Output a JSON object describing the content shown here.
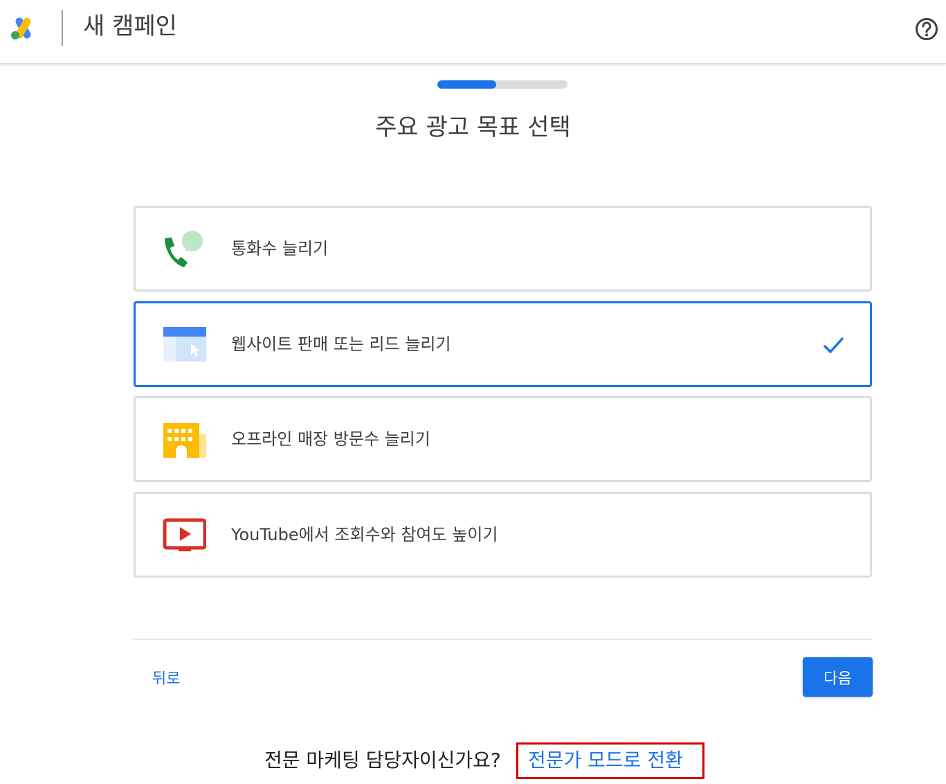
{
  "header": {
    "title": "새 캠페인",
    "logo_icon": "google-ads-logo",
    "help_icon": "help-circle-icon"
  },
  "progress": {
    "fraction": 0.45,
    "color": "#1a73e8"
  },
  "page_title": "주요 광고 목표 선택",
  "options": [
    {
      "label": "통화수 늘리기",
      "icon": "phone-call-icon",
      "selected": false
    },
    {
      "label": "웹사이트 판매 또는 리드 늘리기",
      "icon": "website-click-icon",
      "selected": true
    },
    {
      "label": "오프라인 매장 방문수 늘리기",
      "icon": "store-building-icon",
      "selected": false
    },
    {
      "label": "YouTube에서 조회수와 참여도 높이기",
      "icon": "youtube-play-icon",
      "selected": false
    }
  ],
  "footer": {
    "back_label": "뒤로",
    "next_label": "다음"
  },
  "expert": {
    "question": "전문 마케팅 담당자이신가요?",
    "link_label": "전문가 모드로 전환"
  },
  "colors": {
    "accent": "#1a73e8",
    "border": "#dadce0",
    "highlight_box": "#d50000"
  }
}
